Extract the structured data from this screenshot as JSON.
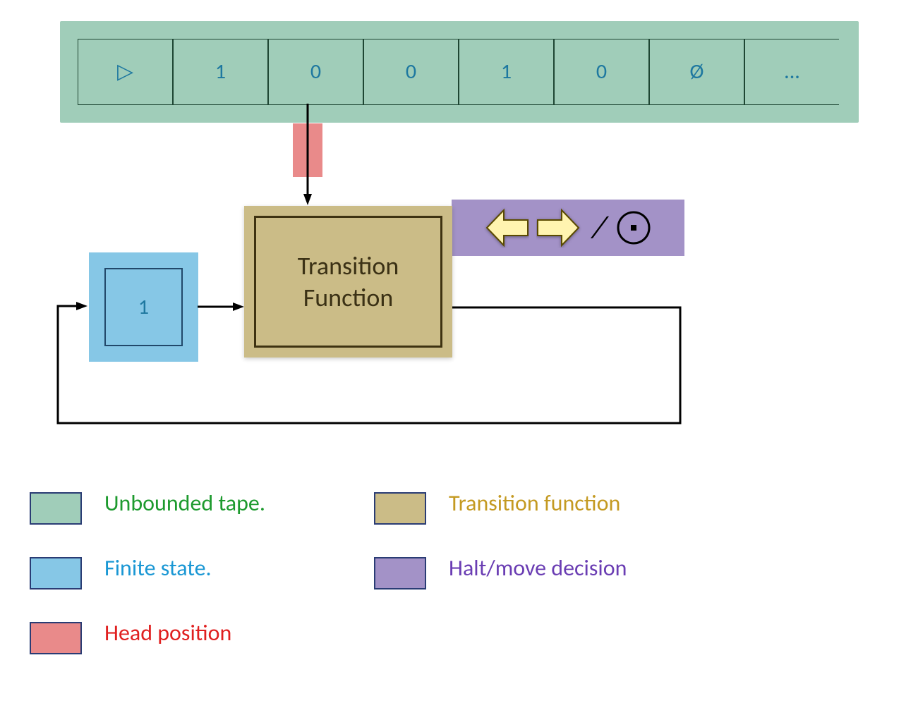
{
  "tape": {
    "cells": [
      "▷",
      "1",
      "0",
      "0",
      "1",
      "0",
      "Ø",
      "..."
    ]
  },
  "state": {
    "value": "1"
  },
  "transition_function": {
    "line1": "Transition",
    "line2": "Function"
  },
  "decision": {
    "slash": "⁄",
    "halt_symbol": "⊙"
  },
  "legend": {
    "tape": "Unbounded tape.",
    "state": "Finite state.",
    "head": "Head position",
    "tf": "Transition function",
    "halt": "Halt/move decision"
  },
  "colors": {
    "tape_bg": "#a0cdb9",
    "state_bg": "#86c7e6",
    "head_bg": "#e98a8a",
    "tf_bg": "#cbbc87",
    "halt_bg": "#a392c7"
  }
}
